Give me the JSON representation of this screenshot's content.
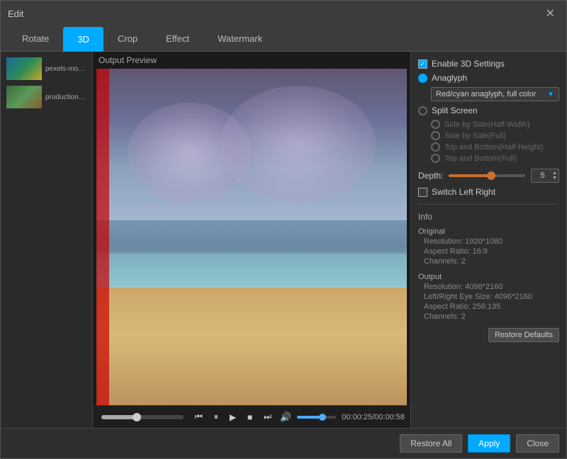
{
  "window": {
    "title": "Edit",
    "close_label": "✕"
  },
  "tabs": [
    {
      "id": "rotate",
      "label": "Rotate",
      "active": false
    },
    {
      "id": "3d",
      "label": "3D",
      "active": true
    },
    {
      "id": "crop",
      "label": "Crop",
      "active": false
    },
    {
      "id": "effect",
      "label": "Effect",
      "active": false
    },
    {
      "id": "watermark",
      "label": "Watermark",
      "active": false
    }
  ],
  "files": [
    {
      "id": "file1",
      "name": "pexels-movie..."
    },
    {
      "id": "file2",
      "name": "production_id..."
    }
  ],
  "video": {
    "preview_label": "Output Preview",
    "time_display": "00:00:25/00:00:58"
  },
  "controls": {
    "play_pause": "⏸",
    "rewind": "⏮",
    "fast_forward": "⏭",
    "stop": "⏹",
    "skip_next": "⏭"
  },
  "settings_3d": {
    "enable_label": "Enable 3D Settings",
    "anaglyph_label": "Anaglyph",
    "anaglyph_option": "Red/cyan anaglyph, full color",
    "split_screen_label": "Split Screen",
    "side_by_side_half": "Side by Side(Half-Width)",
    "side_by_side_full": "Side by Side(Full)",
    "top_bottom_half": "Top and Bottom(Half-Height)",
    "top_bottom_full": "Top and Bottom(Full)",
    "depth_label": "Depth:",
    "depth_value": "5",
    "switch_left_right": "Switch Left Right",
    "restore_defaults": "Restore Defaults"
  },
  "info": {
    "section_title": "Info",
    "original_title": "Original",
    "orig_resolution": "Resolution: 1920*1080",
    "orig_aspect": "Aspect Ratio: 16:9",
    "orig_channels": "Channels: 2",
    "output_title": "Output",
    "out_resolution": "Resolution: 4096*2160",
    "out_eye_size": "Left/Right Eye Size: 4096*2160",
    "out_aspect": "Aspect Ratio: 256:135",
    "out_channels": "Channels: 2"
  },
  "bottom_bar": {
    "restore_all": "Restore All",
    "apply": "Apply",
    "close": "Close"
  }
}
